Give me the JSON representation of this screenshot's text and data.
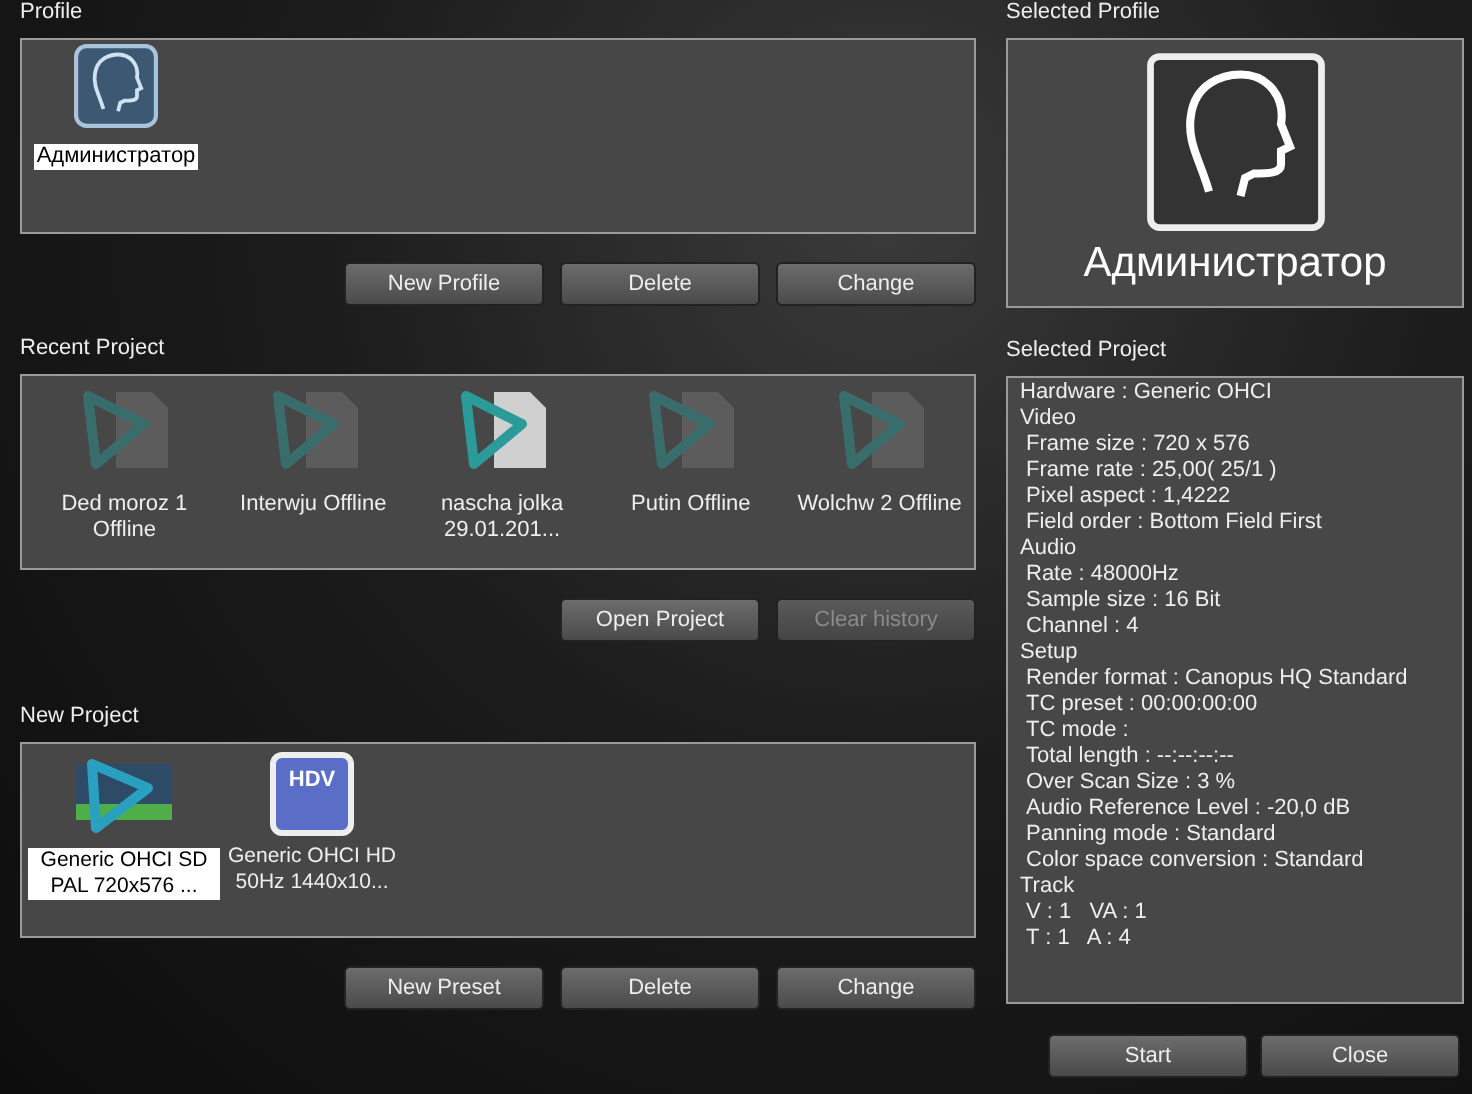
{
  "profile": {
    "label": "Profile",
    "items": [
      {
        "name": "Администратор",
        "selected": true
      }
    ],
    "buttons": [
      {
        "label": "New Profile",
        "disabled": false
      },
      {
        "label": "Delete",
        "disabled": false
      },
      {
        "label": "Change",
        "disabled": false
      }
    ]
  },
  "recent_project": {
    "label": "Recent Project",
    "items": [
      {
        "name": "Ded moroz 1 Offline",
        "selected": false
      },
      {
        "name": "Interwju  Offline",
        "selected": false
      },
      {
        "name": "nascha jolka 29.01.201...",
        "selected": true
      },
      {
        "name": "Putin Offline",
        "selected": false
      },
      {
        "name": "Wolchw 2 Offline",
        "selected": false
      }
    ],
    "buttons": [
      {
        "label": "Open Project",
        "disabled": false
      },
      {
        "label": "Clear history",
        "disabled": true
      }
    ]
  },
  "new_project": {
    "label": "New Project",
    "items": [
      {
        "name": "Generic OHCI SD PAL  720x576 ...",
        "kind": "sd",
        "selected": true
      },
      {
        "name": "Generic OHCI HD 50Hz  1440x10...",
        "kind": "hdv",
        "selected": false,
        "icon_text": "HDV"
      }
    ],
    "buttons": [
      {
        "label": "New Preset",
        "disabled": false
      },
      {
        "label": "Delete",
        "disabled": false
      },
      {
        "label": "Change",
        "disabled": false
      }
    ]
  },
  "selected_profile": {
    "label": "Selected Profile",
    "name": "Администратор"
  },
  "selected_project": {
    "label": "Selected Project",
    "details": [
      {
        "text": "Hardware : Generic OHCI"
      },
      {
        "text": "Video",
        "children": [
          {
            "text": "Frame size : 720 x 576"
          },
          {
            "text": "Frame rate : 25,00( 25/1 )"
          },
          {
            "text": "Pixel aspect : 1,4222"
          },
          {
            "text": "Field order : Bottom Field First"
          }
        ]
      },
      {
        "text": "Audio",
        "children": [
          {
            "text": "Rate : 48000Hz"
          },
          {
            "text": "Sample size : 16 Bit"
          },
          {
            "text": "Channel : 4"
          }
        ]
      },
      {
        "text": "Setup",
        "children": [
          {
            "text": "Render format : Canopus HQ Standard"
          },
          {
            "text": "TC preset : 00:00:00:00"
          },
          {
            "text": "TC mode :"
          },
          {
            "text": "Total length : --:--:--:--"
          },
          {
            "text": "Over Scan Size : 3 %"
          },
          {
            "text": "Audio Reference Level : -20,0 dB"
          },
          {
            "text": "Panning mode : Standard"
          },
          {
            "text": "Color space conversion : Standard"
          }
        ]
      },
      {
        "text": "Track",
        "children": [
          {
            "text": "V : 1   VA : 1"
          },
          {
            "text": "T : 1   A : 4"
          }
        ]
      }
    ]
  },
  "buttons": [
    {
      "label": "Start",
      "disabled": false
    },
    {
      "label": "Close",
      "disabled": false
    }
  ]
}
